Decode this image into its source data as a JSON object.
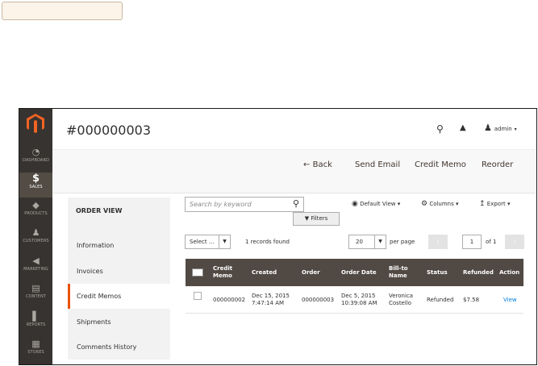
{
  "header": {
    "title": "#000000003",
    "user": "admin"
  },
  "nav": [
    {
      "label": "DASHBOARD",
      "icon": "speedometer-icon"
    },
    {
      "label": "SALES",
      "icon": "dollar-icon"
    },
    {
      "label": "PRODUCTS",
      "icon": "box-icon"
    },
    {
      "label": "CUSTOMERS",
      "icon": "person-icon"
    },
    {
      "label": "MARKETING",
      "icon": "megaphone-icon"
    },
    {
      "label": "CONTENT",
      "icon": "layout-icon"
    },
    {
      "label": "REPORTS",
      "icon": "bar-chart-icon"
    },
    {
      "label": "STORES",
      "icon": "store-icon"
    }
  ],
  "actions": {
    "back": "Back",
    "send_email": "Send Email",
    "credit_memo": "Credit Memo",
    "reorder": "Reorder"
  },
  "order_view": {
    "title": "ORDER VIEW",
    "tabs": [
      "Information",
      "Invoices",
      "Credit Memos",
      "Shipments",
      "Comments History"
    ]
  },
  "toolbar": {
    "search_placeholder": "Search by keyword",
    "filters": "Filters",
    "default_view": "Default View",
    "columns": "Columns",
    "export": "Export",
    "select": "Select ...",
    "records_found": "1 records found",
    "per_page_value": "20",
    "per_page_label": "per page",
    "page": "1",
    "of_pages": "of 1"
  },
  "grid": {
    "headers": [
      "Credit Memo",
      "Created",
      "Order",
      "Order Date",
      "Bill-to Name",
      "Status",
      "Refunded",
      "Action"
    ],
    "rows": [
      {
        "credit_memo": "000000002",
        "created": "Dec 15, 2015 7:47:14 AM",
        "order": "000000003",
        "order_date": "Dec 5, 2015 10:39:08 AM",
        "bill_to": "Veronica Costello",
        "status": "Refunded",
        "refunded": "$7.58",
        "action": "View"
      }
    ]
  },
  "colors": {
    "sidebar": "#373330",
    "accent": "#eb5202",
    "grid_header": "#514943",
    "link": "#007bdb"
  }
}
